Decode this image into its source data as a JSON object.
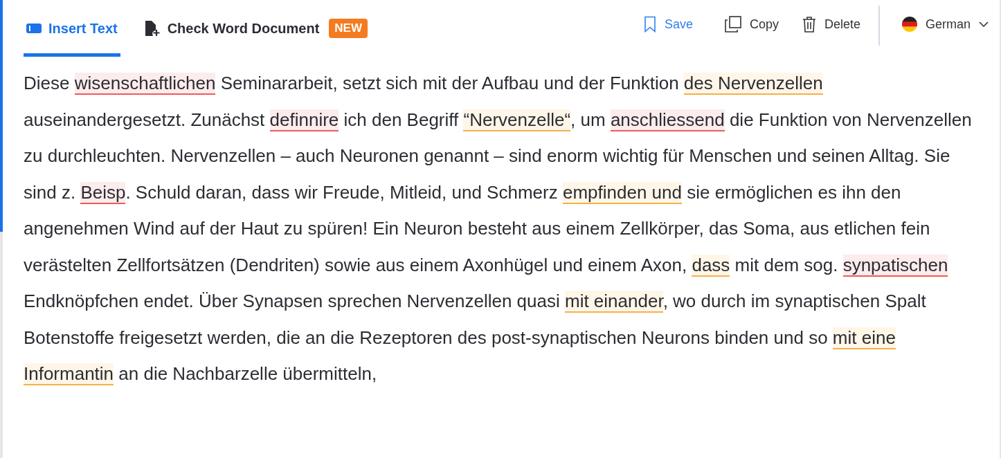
{
  "tabs": [
    {
      "label": "Insert Text",
      "kind": "text",
      "selected": true
    },
    {
      "label": "Check Word Document",
      "kind": "document",
      "selected": false,
      "badge": "NEW"
    }
  ],
  "actions": [
    {
      "label": "Save",
      "kind": "save"
    },
    {
      "label": "Copy",
      "kind": "copy"
    },
    {
      "label": "Delete",
      "kind": "delete"
    }
  ],
  "language": {
    "label": "German"
  },
  "segments": [
    {
      "text": "Diese ",
      "kind": "plain"
    },
    {
      "text": "wisenschaftlichen",
      "kind": "spelling"
    },
    {
      "text": " Seminararbeit, setzt sich mit der Aufbau und der Funktion ",
      "kind": "plain"
    },
    {
      "text": "des Nervenzellen",
      "kind": "grammar"
    },
    {
      "text": " auseinandergesetzt. Zunächst ",
      "kind": "plain"
    },
    {
      "text": "definnire",
      "kind": "spelling"
    },
    {
      "text": " ich den Begriff ",
      "kind": "plain"
    },
    {
      "text": "“Nervenzelle“",
      "kind": "grammar"
    },
    {
      "text": ", um ",
      "kind": "plain"
    },
    {
      "text": "anschliessend",
      "kind": "spelling"
    },
    {
      "text": " die Funktion von Nervenzellen zu durchleuchten. Nervenzellen – auch Neuronen genannt – sind enorm wichtig für Menschen und seinen Alltag. Sie sind z. ",
      "kind": "plain"
    },
    {
      "text": "Beisp",
      "kind": "spelling"
    },
    {
      "text": ". Schuld daran, dass wir Freude, Mitleid, und Schmerz ",
      "kind": "plain"
    },
    {
      "text": "empfinden und",
      "kind": "grammar"
    },
    {
      "text": " sie ermöglichen es ihn den angenehmen Wind auf der Haut zu spüren! Ein Neuron besteht aus einem Zellkörper, das Soma, aus etlichen fein verästelten Zellfortsätzen (Dendriten) sowie aus einem Axonhügel und einem Axon, ",
      "kind": "plain"
    },
    {
      "text": "dass",
      "kind": "grammar"
    },
    {
      "text": " mit dem sog. ",
      "kind": "plain"
    },
    {
      "text": "synpatischen",
      "kind": "spelling"
    },
    {
      "text": " Endknöpfchen endet. Über Synapsen sprechen Nervenzellen quasi ",
      "kind": "plain"
    },
    {
      "text": "mit einander",
      "kind": "grammar"
    },
    {
      "text": ", wo durch im synaptischen Spalt Botenstoffe freigesetzt werden, die an die Rezeptoren des post-synaptischen Neurons binden und so ",
      "kind": "plain"
    },
    {
      "text": "mit eine Informantin",
      "kind": "grammar"
    },
    {
      "text": " an die Nachbarzelle übermitteln,",
      "kind": "plain"
    }
  ]
}
